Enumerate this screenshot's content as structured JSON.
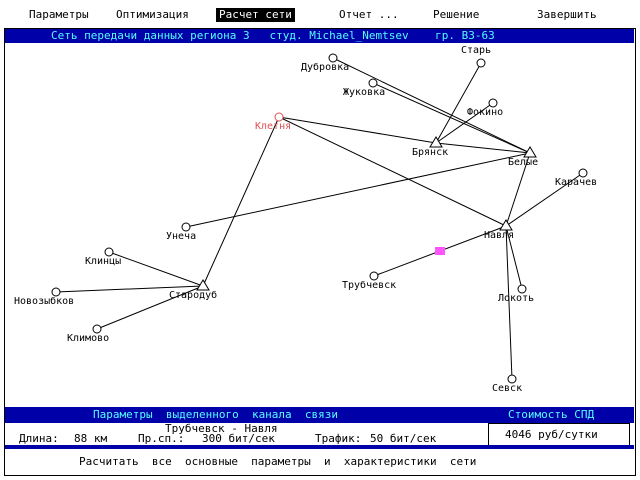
{
  "menu": {
    "items": [
      "Параметры",
      "Оптимизация",
      "Расчет сети",
      "Отчет ...",
      "Решение",
      "Завершить"
    ],
    "active_index": 2
  },
  "title": "Сеть передачи данных региона 3   студ. Michael_Nemtsev    гр. ВЗ-63",
  "colors": {
    "panel_bg": "#0000a8",
    "panel_text": "#55ffff",
    "selected_city": "#e05050",
    "selected_link_marker": "#ff55ff"
  },
  "map": {
    "cities": [
      {
        "name": "Дубровка",
        "role": "terminal"
      },
      {
        "name": "Жуковка",
        "role": "terminal"
      },
      {
        "name": "Старь",
        "role": "terminal"
      },
      {
        "name": "Фокино",
        "role": "terminal"
      },
      {
        "name": "Клетня",
        "role": "terminal-selected"
      },
      {
        "name": "Брянск",
        "role": "node"
      },
      {
        "name": "Белые",
        "role": "node"
      },
      {
        "name": "Карачев",
        "role": "terminal"
      },
      {
        "name": "Унеча",
        "role": "terminal"
      },
      {
        "name": "Навля",
        "role": "node"
      },
      {
        "name": "Клинцы",
        "role": "terminal"
      },
      {
        "name": "Стародуб",
        "role": "node"
      },
      {
        "name": "Новозыбков",
        "role": "terminal"
      },
      {
        "name": "Трубчевск",
        "role": "terminal"
      },
      {
        "name": "Локоть",
        "role": "terminal"
      },
      {
        "name": "Климово",
        "role": "terminal"
      },
      {
        "name": "Севск",
        "role": "terminal"
      }
    ],
    "links": [
      [
        "Дубровка",
        "Белые"
      ],
      [
        "Жуковка",
        "Белые"
      ],
      [
        "Старь",
        "Брянск"
      ],
      [
        "Фокино",
        "Брянск"
      ],
      [
        "Клетня",
        "Брянск"
      ],
      [
        "Клетня",
        "Навля"
      ],
      [
        "Клетня",
        "Стародуб"
      ],
      [
        "Брянск",
        "Белые"
      ],
      [
        "Белые",
        "Навля"
      ],
      [
        "Унеча",
        "Белые"
      ],
      [
        "Карачев",
        "Навля"
      ],
      [
        "Клинцы",
        "Стародуб"
      ],
      [
        "Новозыбков",
        "Стародуб"
      ],
      [
        "Климово",
        "Стародуб"
      ],
      [
        "Трубчевск",
        "Навля"
      ],
      [
        "Локоть",
        "Навля"
      ],
      [
        "Севск",
        "Навля"
      ]
    ]
  },
  "panel": {
    "heading": "Параметры  выделенного  канала  связи",
    "link_name": "Трубчевск - Навля",
    "length_label": "Длина:",
    "length_value": "88 км",
    "bandwidth_label": "Пр.сп.:",
    "bandwidth_value": "300 бит/сек",
    "traffic_label": "Трафик:",
    "traffic_value": "50 бит/сек"
  },
  "cost": {
    "heading": "Стоимость СПД",
    "value": "4046 руб/сутки"
  },
  "status": "Расчитать  все  основные  параметры  и  характеристики  сети"
}
